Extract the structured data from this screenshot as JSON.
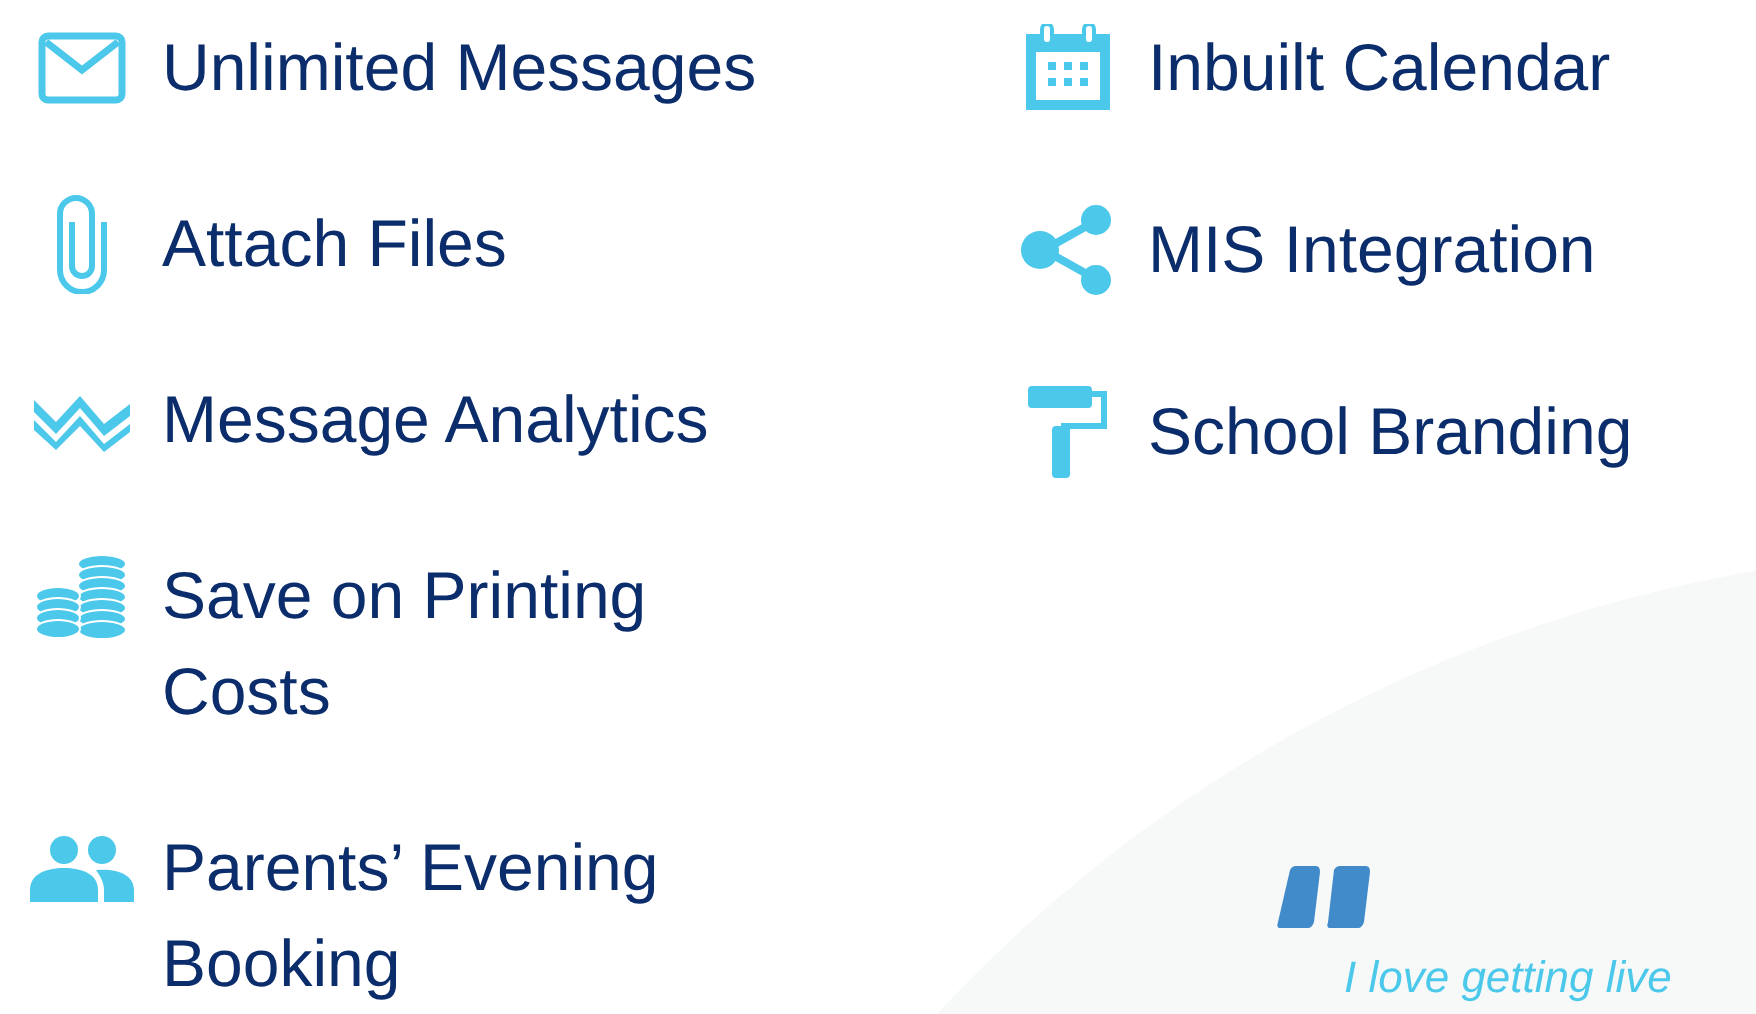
{
  "features_left": [
    {
      "label": "Unlimited Messages"
    },
    {
      "label": "Attach Files"
    },
    {
      "label": "Message Analytics"
    },
    {
      "label": "Save on Printing Costs"
    },
    {
      "label": "Parents’ Evening Booking"
    }
  ],
  "features_right": [
    {
      "label": "Inbuilt Calendar"
    },
    {
      "label": "MIS Integration"
    },
    {
      "label": "School Branding"
    }
  ],
  "testimonial": {
    "quote": "I love getting live"
  }
}
